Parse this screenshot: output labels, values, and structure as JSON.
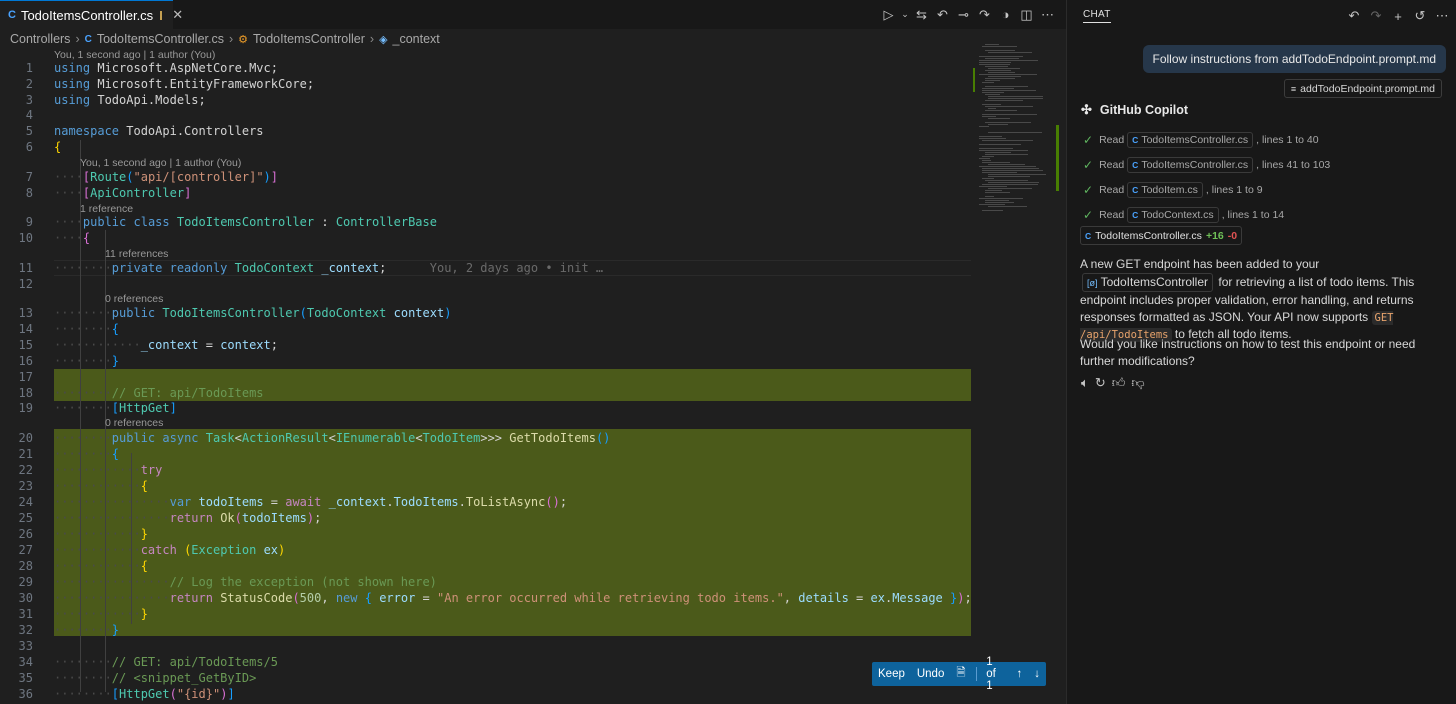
{
  "tab": {
    "icon": "cs-file-icon",
    "label": "TodoItemsController.cs"
  },
  "breadcrumb": [
    "Controllers",
    "TodoItemsController.cs",
    "TodoItemsController",
    "_context"
  ],
  "review_bar": {
    "keep": "Keep",
    "undo": "Undo",
    "counter": "1 of 1"
  },
  "chat": {
    "title": "CHAT",
    "user_message": "Follow instructions from addTodoEndpoint.prompt.md",
    "attachment": "addTodoEndpoint.prompt.md",
    "assistant_name": "GitHub Copilot",
    "read_label": "Read",
    "reads": [
      {
        "file": "TodoItemsController.cs",
        "range": ", lines 1 to 40"
      },
      {
        "file": "TodoItemsController.cs",
        "range": ", lines 41 to 103"
      },
      {
        "file": "TodoItem.cs",
        "range": ", lines 1 to 9"
      },
      {
        "file": "TodoContext.cs",
        "range": ", lines 1 to 14"
      }
    ],
    "changed_file": "TodoItemsController.cs",
    "added": "+16",
    "removed": "-0",
    "p1_a": "A new GET endpoint has been added to your",
    "p1_chip": "TodoItemsController",
    "p1_b": "for retrieving a list of todo items. This endpoint includes proper validation, error handling, and returns responses formatted as JSON. Your API now supports",
    "p1_code": "GET /api/TodoItems",
    "p1_c": "to fetch all todo items.",
    "p2": "Would you like instructions on how to test this endpoint or need further modifications?"
  },
  "code": {
    "lens_top": "You, 1 second ago | 1 author (You)",
    "lens_7": "You, 1 second ago | 1 author (You)",
    "lens_9": "1 reference",
    "lens_11": "11 references",
    "lens_13": "0 references",
    "lens_20": "0 references",
    "blame_11": "You, 2 days ago • init …",
    "line_numbers": [
      "1",
      "2",
      "3",
      "4",
      "5",
      "6",
      "7",
      "8",
      "9",
      "10",
      "11",
      "12",
      "13",
      "14",
      "15",
      "16",
      "17",
      "18",
      "19",
      "20",
      "21",
      "22",
      "23",
      "24",
      "25",
      "26",
      "27",
      "28",
      "29",
      "30",
      "31",
      "32",
      "33",
      "34",
      "35",
      "36"
    ],
    "lines": [
      [
        [
          "kw",
          "using"
        ],
        [
          "pl",
          " Microsoft.AspNetCore.Mvc;"
        ]
      ],
      [
        [
          "kw",
          "using"
        ],
        [
          "pl",
          " Microsoft.EntityFrameworkCore;"
        ]
      ],
      [
        [
          "kw",
          "using"
        ],
        [
          "pl",
          " TodoApi.Models;"
        ]
      ],
      [],
      [
        [
          "kw",
          "namespace"
        ],
        [
          "pl",
          " TodoApi.Controllers"
        ]
      ],
      [
        [
          "br1",
          "{"
        ]
      ],
      [
        [
          "dot",
          "····"
        ],
        [
          "br2",
          "["
        ],
        [
          "ty",
          "Route"
        ],
        [
          "br3",
          "("
        ],
        [
          "str",
          "\"api/[controller]\""
        ],
        [
          "br3",
          ")"
        ],
        [
          "br2",
          "]"
        ]
      ],
      [
        [
          "dot",
          "····"
        ],
        [
          "br2",
          "["
        ],
        [
          "ty",
          "ApiController"
        ],
        [
          "br2",
          "]"
        ]
      ],
      [
        [
          "dot",
          "····"
        ],
        [
          "kw",
          "public"
        ],
        [
          "pl",
          " "
        ],
        [
          "kw",
          "class"
        ],
        [
          "pl",
          " "
        ],
        [
          "ty",
          "TodoItemsController"
        ],
        [
          "pl",
          " : "
        ],
        [
          "ty",
          "ControllerBase"
        ]
      ],
      [
        [
          "dot",
          "····"
        ],
        [
          "br2",
          "{"
        ]
      ],
      [
        [
          "dot",
          "········"
        ],
        [
          "kw",
          "private"
        ],
        [
          "pl",
          " "
        ],
        [
          "kw",
          "readonly"
        ],
        [
          "pl",
          " "
        ],
        [
          "ty",
          "TodoContext"
        ],
        [
          "pl",
          " "
        ],
        [
          "vr",
          "_context"
        ],
        [
          "pl",
          ";"
        ]
      ],
      [],
      [
        [
          "dot",
          "········"
        ],
        [
          "kw",
          "public"
        ],
        [
          "pl",
          " "
        ],
        [
          "ty",
          "TodoItemsController"
        ],
        [
          "br3",
          "("
        ],
        [
          "ty",
          "TodoContext"
        ],
        [
          "pl",
          " "
        ],
        [
          "vr",
          "context"
        ],
        [
          "br3",
          ")"
        ]
      ],
      [
        [
          "dot",
          "········"
        ],
        [
          "br3",
          "{"
        ]
      ],
      [
        [
          "dot",
          "············"
        ],
        [
          "vr",
          "_context"
        ],
        [
          "pl",
          " = "
        ],
        [
          "vr",
          "context"
        ],
        [
          "pl",
          ";"
        ]
      ],
      [
        [
          "dot",
          "········"
        ],
        [
          "br3",
          "}"
        ]
      ],
      [],
      [
        [
          "dot",
          "········"
        ],
        [
          "cm",
          "// GET: api/TodoItems"
        ]
      ],
      [
        [
          "dot",
          "········"
        ],
        [
          "br3",
          "["
        ],
        [
          "ty",
          "HttpGet"
        ],
        [
          "br3",
          "]"
        ]
      ],
      [
        [
          "dot",
          "········"
        ],
        [
          "kw",
          "public"
        ],
        [
          "pl",
          " "
        ],
        [
          "kw",
          "async"
        ],
        [
          "pl",
          " "
        ],
        [
          "ty",
          "Task"
        ],
        [
          "pl",
          "<"
        ],
        [
          "ty",
          "ActionResult"
        ],
        [
          "pl",
          "<"
        ],
        [
          "ty",
          "IEnumerable"
        ],
        [
          "pl",
          "<"
        ],
        [
          "ty",
          "TodoItem"
        ],
        [
          "pl",
          ">>> "
        ],
        [
          "fn",
          "GetTodoItems"
        ],
        [
          "br3",
          "()"
        ]
      ],
      [
        [
          "dot",
          "········"
        ],
        [
          "br3",
          "{"
        ]
      ],
      [
        [
          "dot",
          "············"
        ],
        [
          "ctl",
          "try"
        ]
      ],
      [
        [
          "dot",
          "············"
        ],
        [
          "br1",
          "{"
        ]
      ],
      [
        [
          "dot",
          "················"
        ],
        [
          "kw",
          "var"
        ],
        [
          "pl",
          " "
        ],
        [
          "vr",
          "todoItems"
        ],
        [
          "pl",
          " = "
        ],
        [
          "ctl",
          "await"
        ],
        [
          "pl",
          " "
        ],
        [
          "vr",
          "_context"
        ],
        [
          "pl",
          "."
        ],
        [
          "vr",
          "TodoItems"
        ],
        [
          "pl",
          "."
        ],
        [
          "fn",
          "ToListAsync"
        ],
        [
          "br2",
          "()"
        ],
        [
          "pl",
          ";"
        ]
      ],
      [
        [
          "dot",
          "················"
        ],
        [
          "ctl",
          "return"
        ],
        [
          "pl",
          " "
        ],
        [
          "fn",
          "Ok"
        ],
        [
          "br2",
          "("
        ],
        [
          "vr",
          "todoItems"
        ],
        [
          "br2",
          ")"
        ],
        [
          "pl",
          ";"
        ]
      ],
      [
        [
          "dot",
          "············"
        ],
        [
          "br1",
          "}"
        ]
      ],
      [
        [
          "dot",
          "············"
        ],
        [
          "ctl",
          "catch"
        ],
        [
          "pl",
          " "
        ],
        [
          "br1",
          "("
        ],
        [
          "ty",
          "Exception"
        ],
        [
          "pl",
          " "
        ],
        [
          "vr",
          "ex"
        ],
        [
          "br1",
          ")"
        ]
      ],
      [
        [
          "dot",
          "············"
        ],
        [
          "br1",
          "{"
        ]
      ],
      [
        [
          "dot",
          "················"
        ],
        [
          "cm",
          "// Log the exception (not shown here)"
        ]
      ],
      [
        [
          "dot",
          "················"
        ],
        [
          "ctl",
          "return"
        ],
        [
          "pl",
          " "
        ],
        [
          "fn",
          "StatusCode"
        ],
        [
          "br2",
          "("
        ],
        [
          "nm",
          "500"
        ],
        [
          "pl",
          ", "
        ],
        [
          "kw",
          "new"
        ],
        [
          "pl",
          " "
        ],
        [
          "br3",
          "{"
        ],
        [
          "pl",
          " "
        ],
        [
          "vr",
          "error"
        ],
        [
          "pl",
          " = "
        ],
        [
          "str",
          "\"An error occurred while retrieving todo items.\""
        ],
        [
          "pl",
          ", "
        ],
        [
          "vr",
          "details"
        ],
        [
          "pl",
          " = "
        ],
        [
          "vr",
          "ex"
        ],
        [
          "pl",
          "."
        ],
        [
          "vr",
          "Message"
        ],
        [
          "pl",
          " "
        ],
        [
          "br3",
          "}"
        ],
        [
          "br2",
          ")"
        ],
        [
          "pl",
          ";"
        ]
      ],
      [
        [
          "dot",
          "············"
        ],
        [
          "br1",
          "}"
        ]
      ],
      [
        [
          "dot",
          "········"
        ],
        [
          "br3",
          "}"
        ]
      ],
      [],
      [
        [
          "dot",
          "········"
        ],
        [
          "cm",
          "// GET: api/TodoItems/5"
        ]
      ],
      [
        [
          "dot",
          "········"
        ],
        [
          "cm",
          "// <snippet_GetByID>"
        ]
      ],
      [
        [
          "dot",
          "········"
        ],
        [
          "br3",
          "["
        ],
        [
          "ty",
          "HttpGet"
        ],
        [
          "br2",
          "("
        ],
        [
          "str",
          "\"{id}\""
        ],
        [
          "br2",
          ")"
        ],
        [
          "br3",
          "]"
        ]
      ]
    ]
  },
  "icons": {
    "tab_actions": [
      "run-icon",
      "chevron-down-icon",
      "compare-changes-icon",
      "go-back-icon",
      "timeline-icon",
      "go-forward-icon",
      "copilot-icon",
      "split-editor-icon",
      "more-icon"
    ],
    "chat_actions": [
      "undo-icon",
      "redo-icon",
      "new-chat-icon",
      "history-icon",
      "more-icon"
    ]
  },
  "colors": {
    "added_highlight": "#4b5a1a",
    "accent": "#0e639c"
  }
}
